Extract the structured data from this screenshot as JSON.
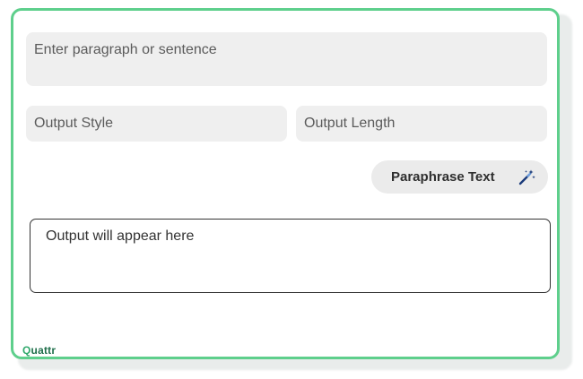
{
  "form": {
    "paragraph_placeholder": "Enter paragraph or sentence",
    "output_style_label": "Output Style",
    "output_length_label": "Output Length",
    "paraphrase_button_label": "Paraphrase Text",
    "output_placeholder": "Output will appear here"
  },
  "brand": {
    "logo_first": "Q",
    "logo_rest": "uattr"
  },
  "colors": {
    "border_accent": "#5ecf8c",
    "field_background": "#efefef",
    "button_background": "#ebebeb",
    "logo_green": "#2fa86b",
    "icon_blue": "#1a3a7a"
  }
}
